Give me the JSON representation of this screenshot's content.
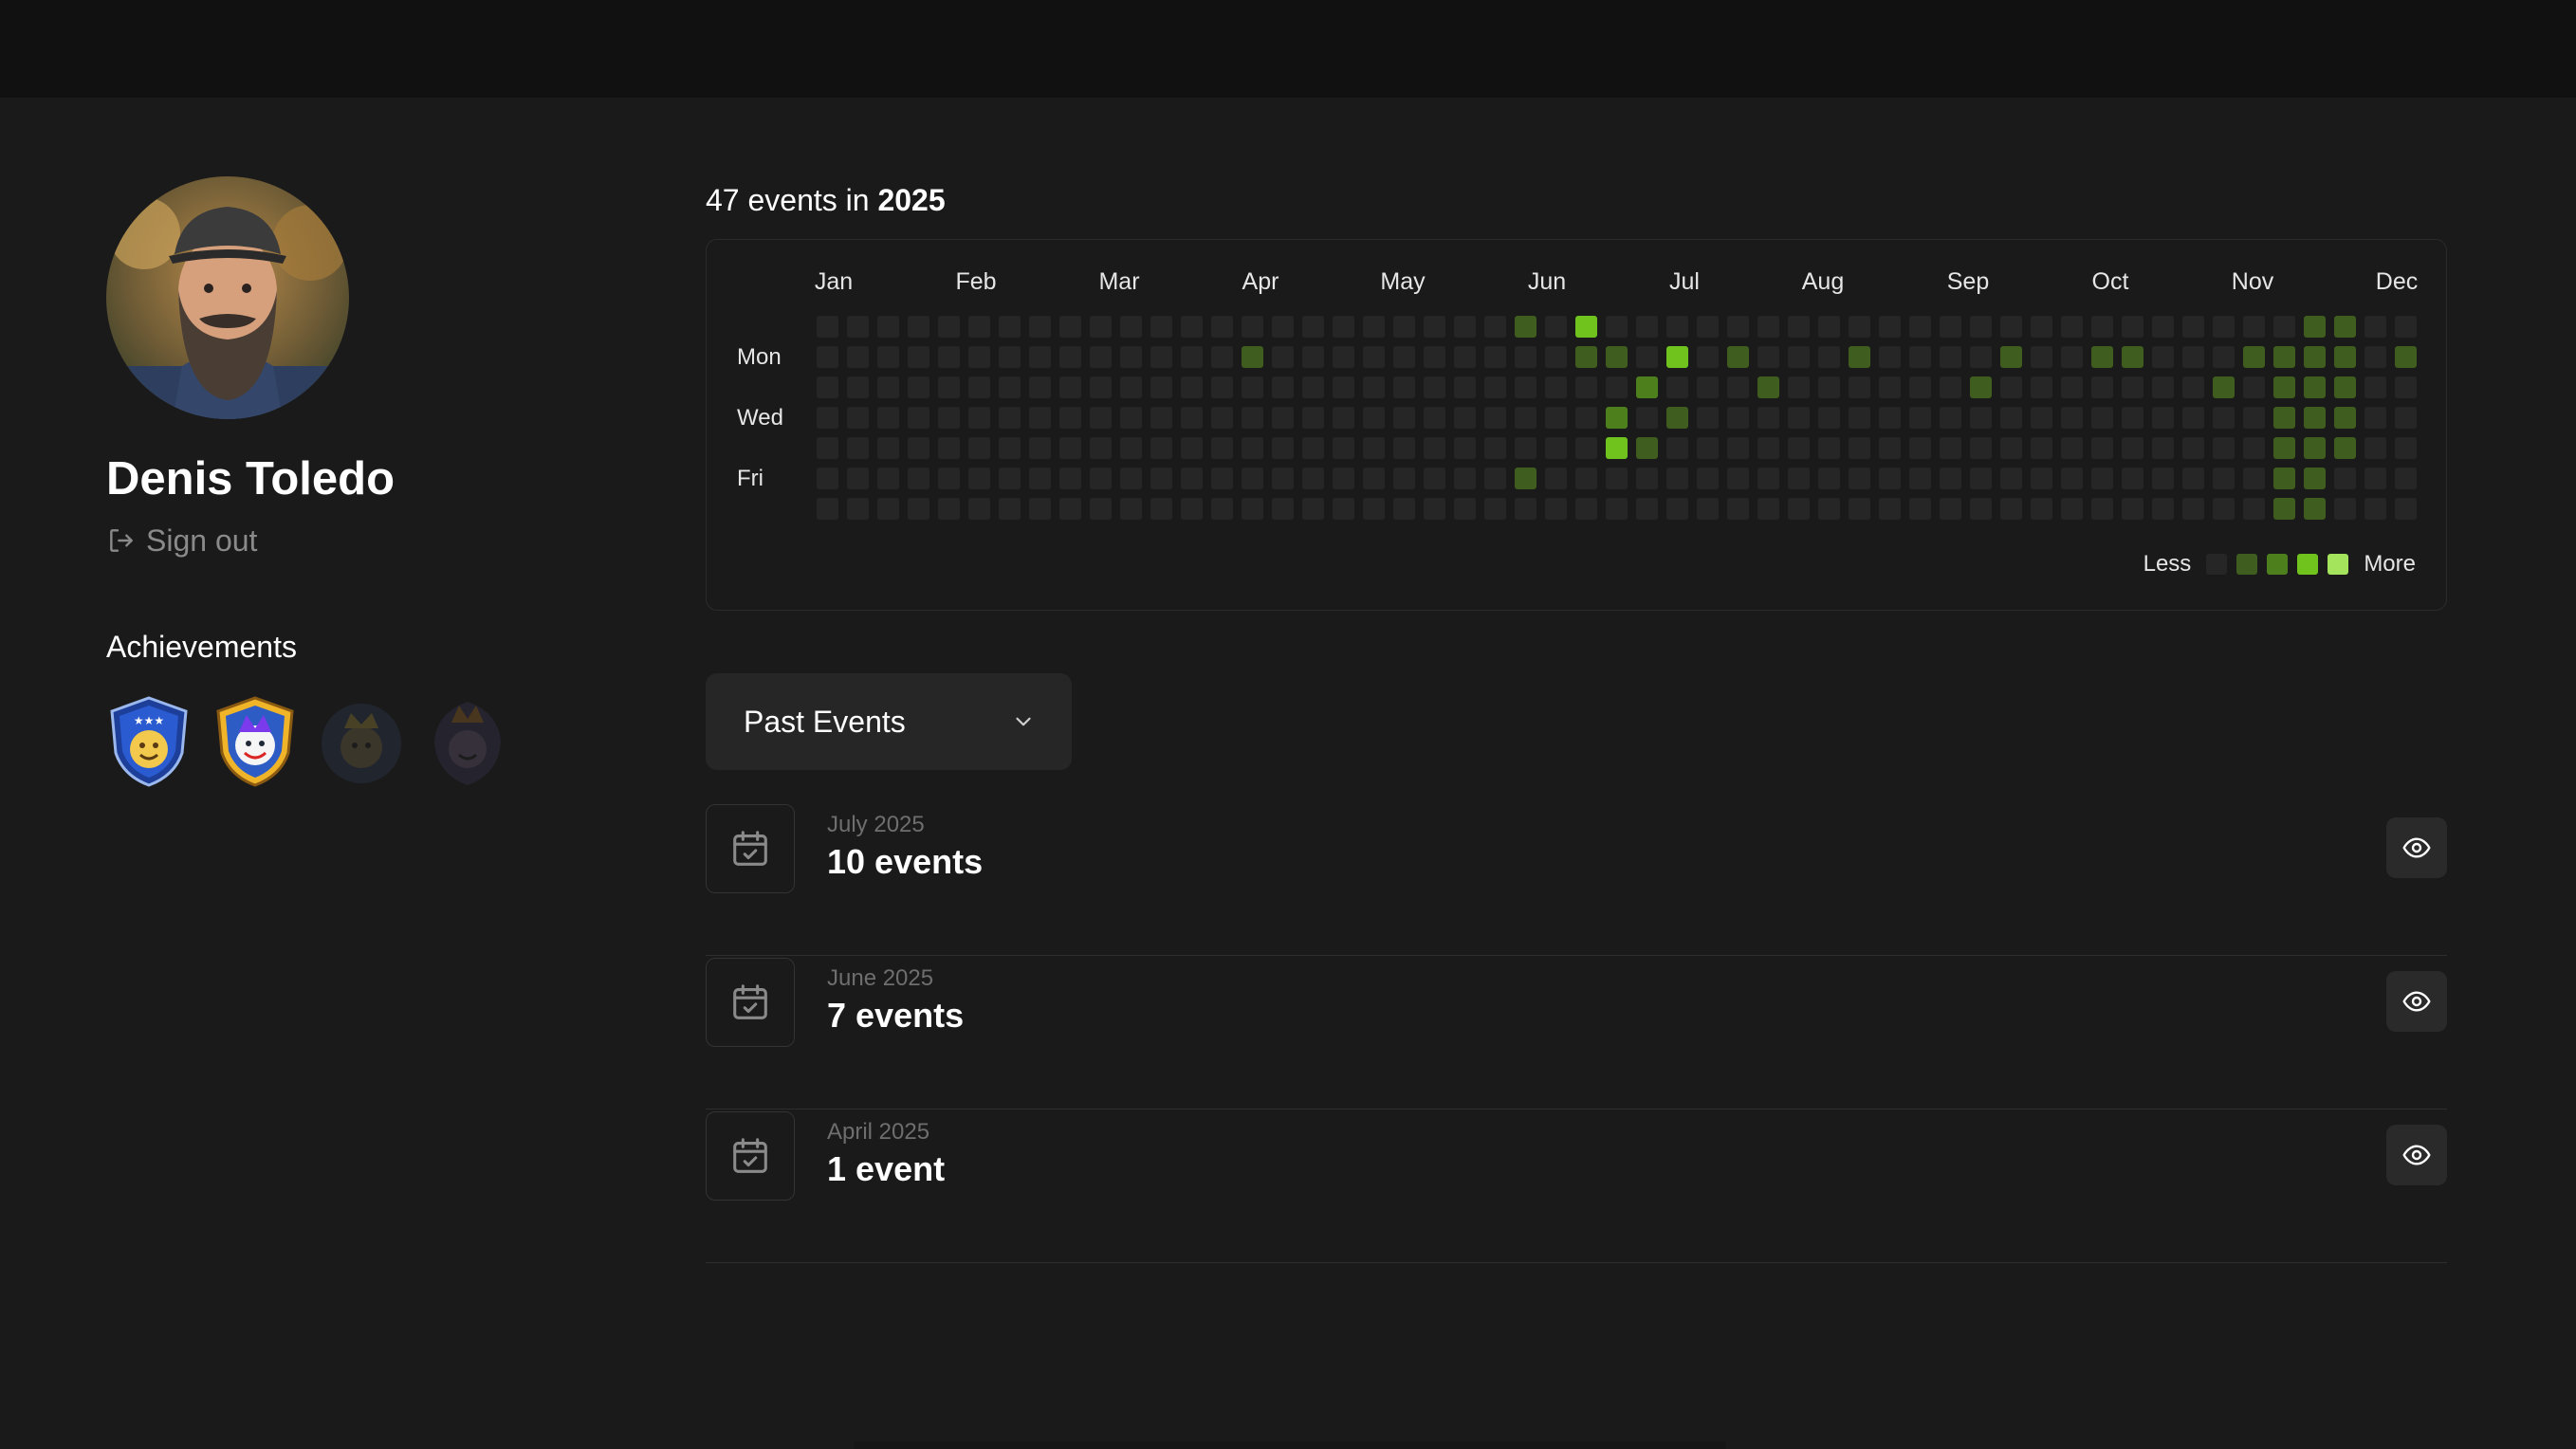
{
  "profile": {
    "name": "Denis Toledo",
    "signout_label": "Sign out"
  },
  "achievements": {
    "title": "Achievements",
    "badges": [
      {
        "name": "champion-badge",
        "unlocked": true
      },
      {
        "name": "jester-badge",
        "unlocked": true
      },
      {
        "name": "king-badge",
        "unlocked": false
      },
      {
        "name": "crown-badge",
        "unlocked": false
      }
    ]
  },
  "activity": {
    "count_text": "47 events in",
    "year": "2025",
    "months": [
      "Jan",
      "Feb",
      "Mar",
      "Apr",
      "May",
      "Jun",
      "Jul",
      "Aug",
      "Sep",
      "Oct",
      "Nov",
      "Dec"
    ],
    "day_labels": [
      "Mon",
      "Wed",
      "Fri"
    ],
    "legend_less": "Less",
    "legend_more": "More",
    "colors": [
      "#262626",
      "#3e5d1e",
      "#4d7f1c",
      "#70c21d",
      "#a4e35c"
    ],
    "active_cells": [
      {
        "week": 23,
        "day": 0,
        "level": 1
      },
      {
        "week": 25,
        "day": 0,
        "level": 3
      },
      {
        "week": 14,
        "day": 1,
        "level": 1
      },
      {
        "week": 25,
        "day": 1,
        "level": 1
      },
      {
        "week": 26,
        "day": 1,
        "level": 1
      },
      {
        "week": 28,
        "day": 1,
        "level": 3
      },
      {
        "week": 30,
        "day": 1,
        "level": 1
      },
      {
        "week": 34,
        "day": 1,
        "level": 1
      },
      {
        "week": 39,
        "day": 1,
        "level": 1
      },
      {
        "week": 42,
        "day": 1,
        "level": 1
      },
      {
        "week": 43,
        "day": 1,
        "level": 1
      },
      {
        "week": 47,
        "day": 1,
        "level": 1
      },
      {
        "week": 48,
        "day": 1,
        "level": 1
      },
      {
        "week": 49,
        "day": 1,
        "level": 1
      },
      {
        "week": 50,
        "day": 1,
        "level": 1
      },
      {
        "week": 52,
        "day": 1,
        "level": 1
      },
      {
        "week": 27,
        "day": 2,
        "level": 2
      },
      {
        "week": 31,
        "day": 2,
        "level": 1
      },
      {
        "week": 38,
        "day": 2,
        "level": 1
      },
      {
        "week": 46,
        "day": 2,
        "level": 1
      },
      {
        "week": 48,
        "day": 2,
        "level": 1
      },
      {
        "week": 49,
        "day": 2,
        "level": 1
      },
      {
        "week": 50,
        "day": 2,
        "level": 1
      },
      {
        "week": 26,
        "day": 3,
        "level": 2
      },
      {
        "week": 28,
        "day": 3,
        "level": 1
      },
      {
        "week": 48,
        "day": 3,
        "level": 1
      },
      {
        "week": 49,
        "day": 3,
        "level": 1
      },
      {
        "week": 50,
        "day": 3,
        "level": 1
      },
      {
        "week": 26,
        "day": 4,
        "level": 3
      },
      {
        "week": 27,
        "day": 4,
        "level": 1
      },
      {
        "week": 48,
        "day": 4,
        "level": 1
      },
      {
        "week": 49,
        "day": 4,
        "level": 1
      },
      {
        "week": 50,
        "day": 4,
        "level": 1
      },
      {
        "week": 23,
        "day": 5,
        "level": 1
      },
      {
        "week": 48,
        "day": 5,
        "level": 1
      },
      {
        "week": 49,
        "day": 5,
        "level": 1
      },
      {
        "week": 48,
        "day": 6,
        "level": 1
      },
      {
        "week": 49,
        "day": 6,
        "level": 1
      },
      {
        "week": 49,
        "day": 0,
        "level": 1
      },
      {
        "week": 50,
        "day": 0,
        "level": 1
      }
    ]
  },
  "filter": {
    "selected": "Past Events"
  },
  "events": [
    {
      "month": "July 2025",
      "count": "10 events"
    },
    {
      "month": "June 2025",
      "count": "7 events"
    },
    {
      "month": "April 2025",
      "count": "1 event"
    }
  ]
}
